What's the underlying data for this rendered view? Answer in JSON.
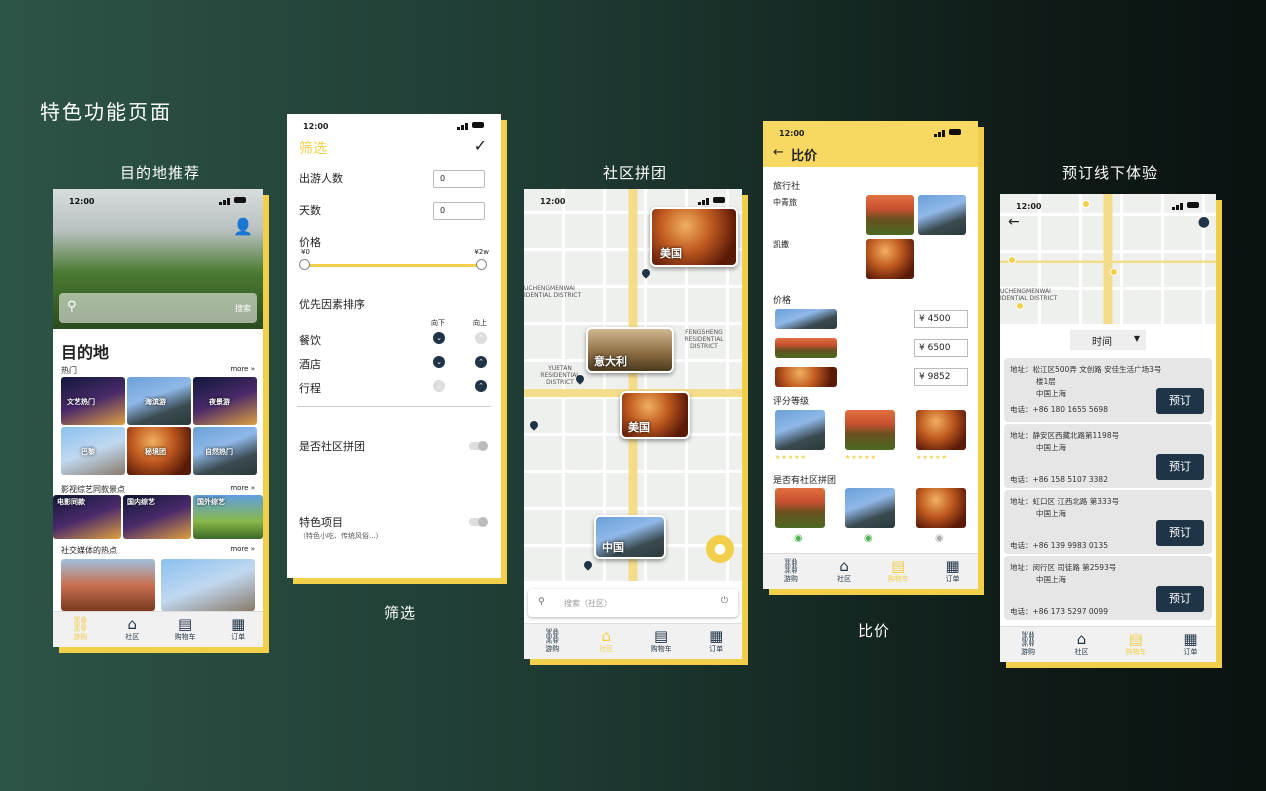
{
  "page": {
    "title": "特色功能页面"
  },
  "captions": {
    "destination": "目的地推荐",
    "filter": "筛选",
    "community": "社区拼团",
    "compare": "比价",
    "booking": "预订线下体验"
  },
  "status_time": "12:00",
  "tabs": {
    "explore": "游购",
    "community": "社区",
    "cart": "购物车",
    "orders": "订单"
  },
  "destination": {
    "search_btn": "搜索",
    "heading": "目的地",
    "more": "more",
    "section_hot": "热门",
    "hot_items": [
      "文艺热门",
      "海滨游",
      "夜景游",
      "巴黎",
      "秘境团",
      "自然热门"
    ],
    "section_film": "影视综艺同款景点",
    "film_items": [
      "电影同款",
      "国内综艺",
      "国外综艺"
    ],
    "section_social": "社交媒体的热点"
  },
  "filter": {
    "title": "筛选",
    "confirm_icon": "✓",
    "travelers_label": "出游人数",
    "travelers_value": "0",
    "days_label": "天数",
    "days_value": "0",
    "price_label": "价格",
    "price_min": "¥0",
    "price_max": "¥2w",
    "priority_label": "优先因素排序",
    "col_down": "向下",
    "col_up": "向上",
    "factor_food": "餐饮",
    "factor_hotel": "酒店",
    "factor_trip": "行程",
    "group_label": "是否社区拼团",
    "special_label": "特色项目",
    "special_sub": "（特色小吃、传统风俗...）"
  },
  "community": {
    "map_labels": [
      "美国",
      "意大利",
      "美国",
      "中国"
    ],
    "district_1": "UCHENGMENWAI IDENTIAL DISTRICT",
    "district_2": "FENGSHENG RESIDENTIAL DISTRICT",
    "district_3": "YUETAN RESIDENTIAL DISTRICT",
    "search_placeholder": "搜索（社区）"
  },
  "compare": {
    "title": "比价",
    "agency_label": "旅行社",
    "agency_1": "中青旅",
    "agency_2": "凯撒",
    "price_label": "价格",
    "prices": [
      "¥ 4500",
      "¥ 6500",
      "¥ 9852"
    ],
    "rating_label": "评分等级",
    "group_label": "是否有社区拼团"
  },
  "booking": {
    "district": "UCHENGMENWAI IDENTIAL DISTRICT",
    "sort_label": "时间",
    "book_label": "预订",
    "entries": [
      {
        "addr1": "地址：松江区500弄 文创路 安佳生活广场3号",
        "addr2": "楼1层",
        "city": "中国上海",
        "phone": "电话：+86 180 1655 5698"
      },
      {
        "addr1": "地址：静安区西藏北路第1198号",
        "addr2": "",
        "city": "中国上海",
        "phone": "电话：+86 158 5107 3382"
      },
      {
        "addr1": "地址：虹口区 江西北路 第333号",
        "addr2": "",
        "city": "中国上海",
        "phone": "电话：+86 139 9983 0135"
      },
      {
        "addr1": "地址：闵行区 司徒路 第2593号",
        "addr2": "",
        "city": "中国上海",
        "phone": "电话：+86 173 5297 0099"
      }
    ]
  },
  "colors": {
    "accent": "#f2cf4a",
    "navy": "#1f3447"
  }
}
